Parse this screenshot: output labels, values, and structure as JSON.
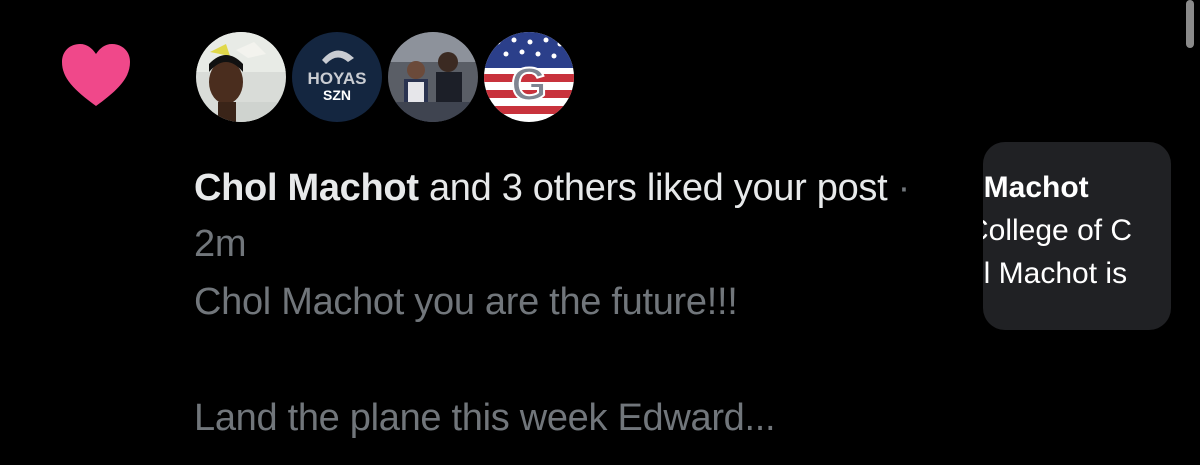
{
  "notification": {
    "actor": "Chol Machot",
    "action_text": " and 3 others liked your post",
    "separator": " · ",
    "time": "2m",
    "post_line_1": "Chol Machot you are the future!!!",
    "post_line_2": "Land the plane this week Edward..."
  },
  "avatars": [
    {
      "icon": "user-avatar-illustration",
      "badge_text": ""
    },
    {
      "icon": "hoyas-szn-logo",
      "badge_text": "HOYAS SZN"
    },
    {
      "icon": "user-avatar-photo",
      "badge_text": ""
    },
    {
      "icon": "georgetown-flag-logo",
      "badge_text": "G"
    }
  ],
  "post_card": {
    "line_1": "l Machot",
    "line_2": "College of C",
    "line_3": "ol Machot is"
  },
  "colors": {
    "heart": "#f0488a",
    "primary_text": "#e7e9ea",
    "secondary_text": "#71767b",
    "background": "#000000",
    "card_background": "#202124"
  }
}
